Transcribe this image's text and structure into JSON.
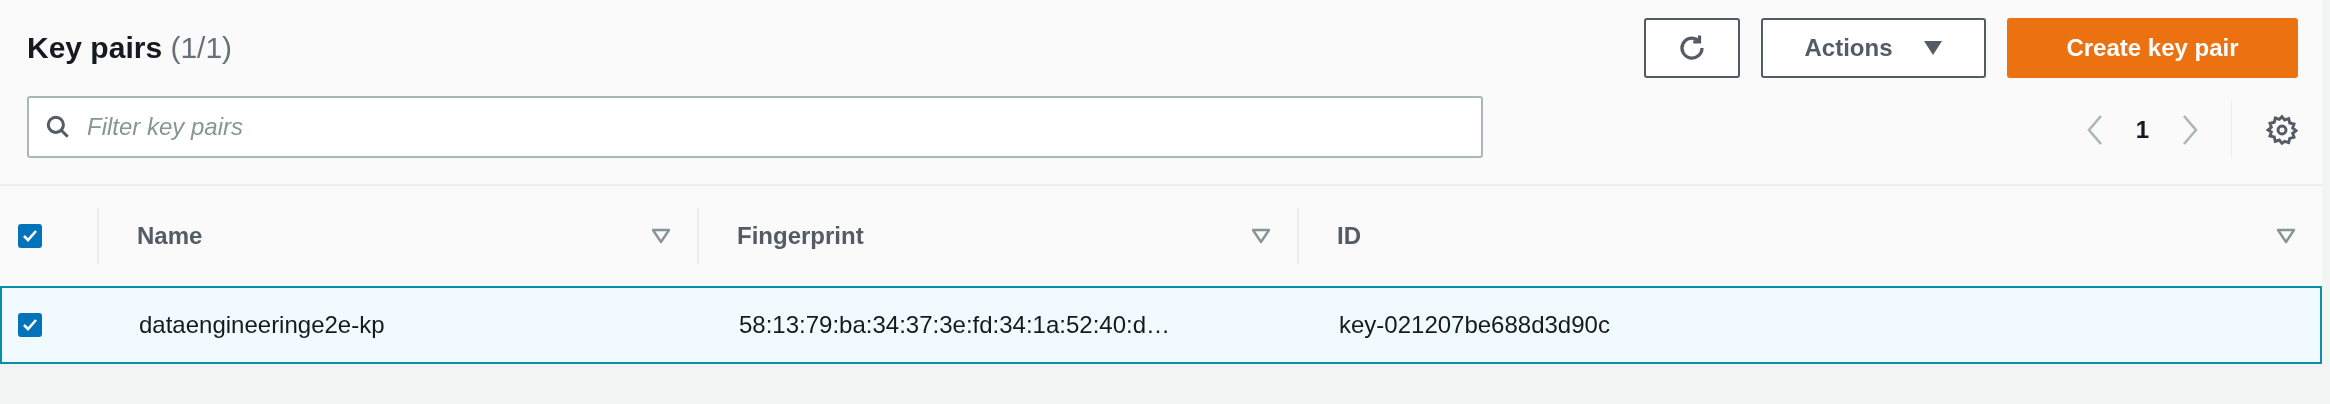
{
  "header": {
    "title": "Key pairs",
    "count": "(1/1)"
  },
  "buttons": [
    {
      "kind": "refresh"
    },
    {
      "kind": "dropdown",
      "label": "Actions"
    },
    {
      "kind": "primary",
      "label": "Create key pair"
    }
  ],
  "filter": {
    "placeholder": "Filter key pairs"
  },
  "pagination": {
    "page": "1",
    "prev_disabled": true,
    "next_disabled": true
  },
  "table": {
    "select_all_checked": true,
    "columns": [
      {
        "label": "Name"
      },
      {
        "label": "Fingerprint"
      },
      {
        "label": "ID"
      }
    ],
    "rows": [
      {
        "selected": true,
        "cells": [
          "dataengineeringe2e-kp",
          "58:13:79:ba:34:37:3e:fd:34:1a:52:40:d…",
          "key-021207be688d3d90c"
        ]
      }
    ]
  }
}
